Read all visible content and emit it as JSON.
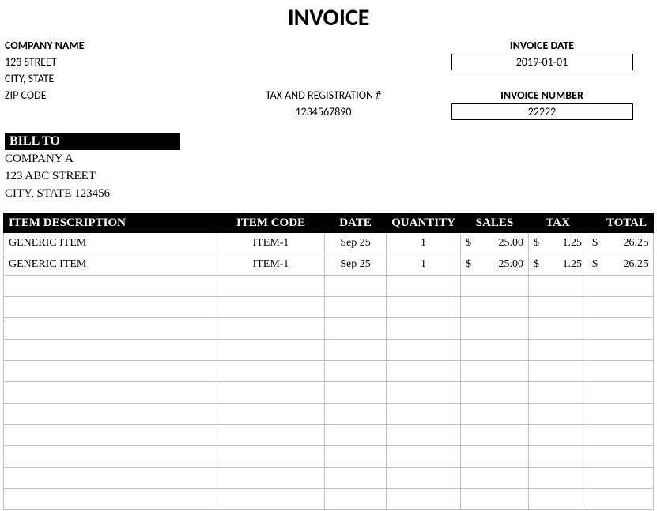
{
  "title": "INVOICE",
  "company": {
    "name_label": "COMPANY NAME",
    "street": "123 STREET",
    "citystate": "CITY, STATE",
    "zip": "ZIP CODE"
  },
  "tax": {
    "label": "TAX AND REGISTRATION #",
    "value": "1234567890"
  },
  "invoice_date": {
    "label": "INVOICE DATE",
    "value": "2019-01-01"
  },
  "invoice_number": {
    "label": "INVOICE NUMBER",
    "value": "22222"
  },
  "billto": {
    "header": "BILL TO",
    "name": "COMPANY A",
    "street": "123 ABC STREET",
    "citystatezip": "CITY, STATE 123456"
  },
  "columns": {
    "desc": "ITEM DESCRIPTION",
    "code": "ITEM CODE",
    "date": "DATE",
    "qty": "QUANTITY",
    "sales": "SALES",
    "tax": "TAX",
    "total": "TOTAL"
  },
  "currency": "$",
  "items": [
    {
      "desc": "GENERIC ITEM",
      "code": "ITEM-1",
      "date": "Sep 25",
      "qty": "1",
      "sales": "25.00",
      "tax": "1.25",
      "total": "26.25"
    },
    {
      "desc": "GENERIC ITEM",
      "code": "ITEM-1",
      "date": "Sep 25",
      "qty": "1",
      "sales": "25.00",
      "tax": "1.25",
      "total": "26.25"
    }
  ],
  "empty_rows": 11
}
